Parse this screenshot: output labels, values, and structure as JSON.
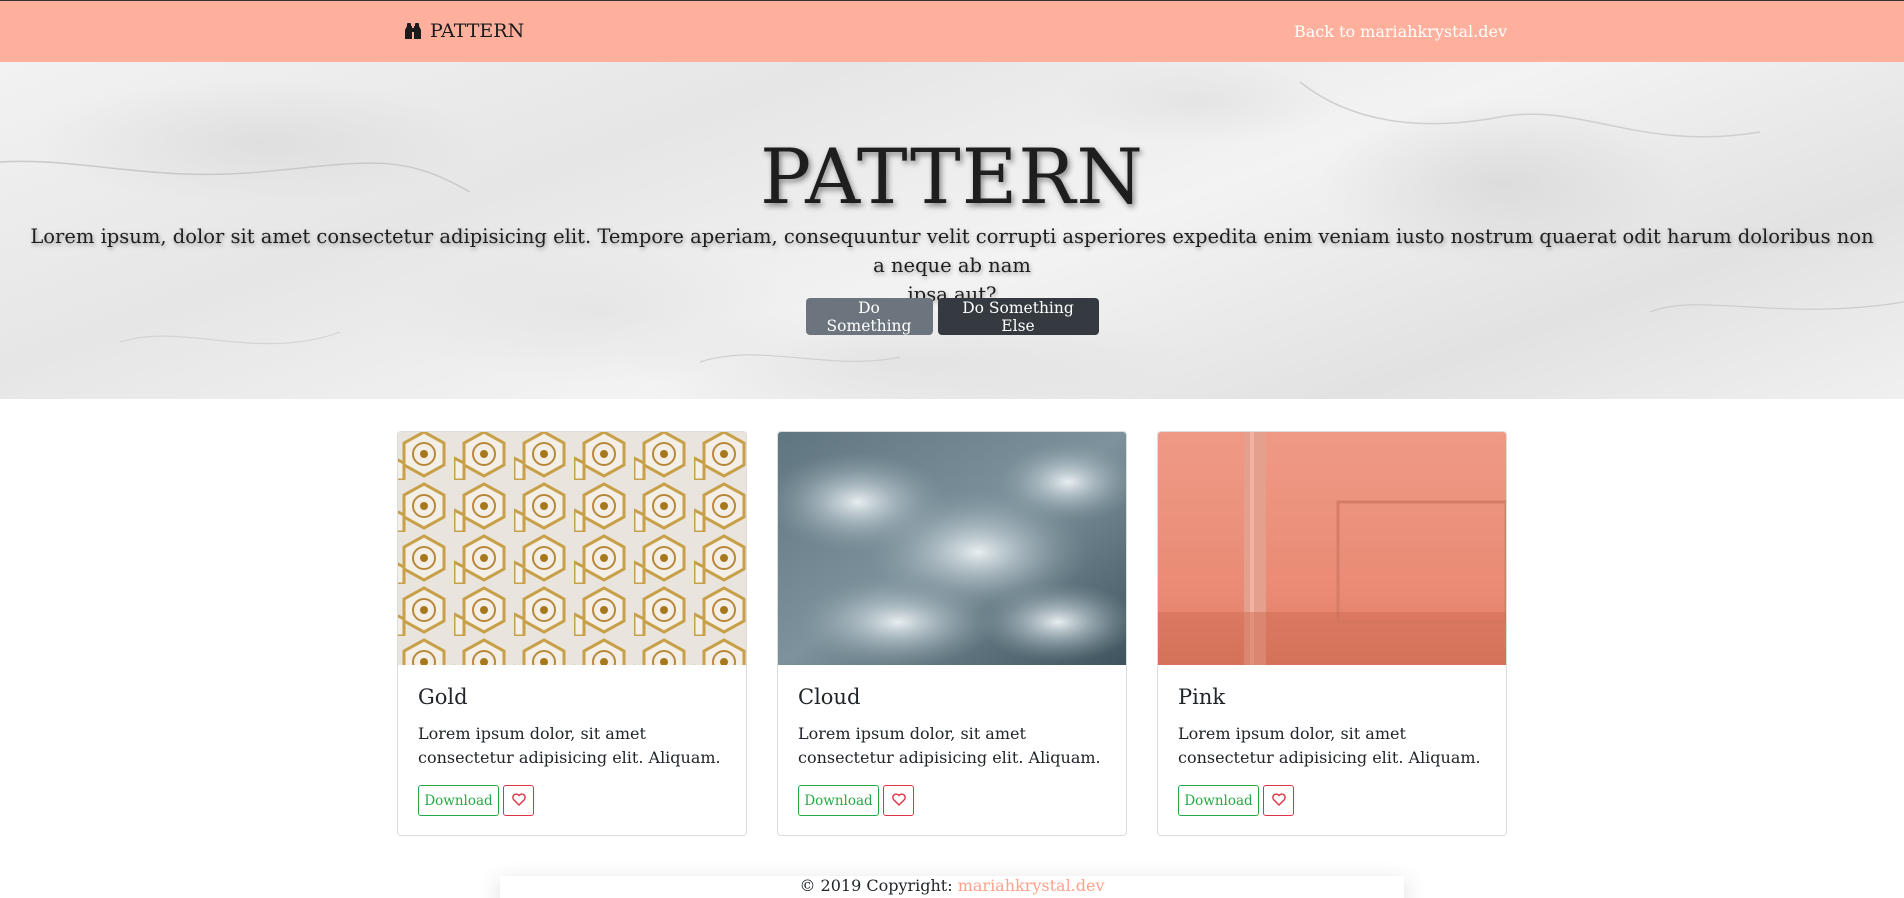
{
  "navbar": {
    "brand_icon": "binoculars-icon",
    "brand_label": "PATTERN",
    "back_link": "Back to mariahkrystal.dev",
    "background": "#ffb09c"
  },
  "hero": {
    "title": "PATTERN",
    "text_line1": "Lorem ipsum, dolor sit amet consectetur adipisicing elit. Tempore aperiam, consequuntur velit corrupti asperiores expedita enim veniam iusto nostrum quaerat odit harum doloribus non a neque ab nam",
    "text_line2": "ipsa aut?",
    "primary_button": "Do Something",
    "secondary_button": "Do Something Else"
  },
  "cards": [
    {
      "title": "Gold",
      "text": "Lorem ipsum dolor, sit amet consectetur adipisicing elit. Aliquam.",
      "download_label": "Download",
      "like_icon": "heart-icon"
    },
    {
      "title": "Cloud",
      "text": "Lorem ipsum dolor, sit amet consectetur adipisicing elit. Aliquam.",
      "download_label": "Download",
      "like_icon": "heart-icon"
    },
    {
      "title": "Pink",
      "text": "Lorem ipsum dolor, sit amet consectetur adipisicing elit. Aliquam.",
      "download_label": "Download",
      "like_icon": "heart-icon"
    }
  ],
  "footer": {
    "copyright": "© 2019 Copyright: ",
    "link": "mariahkrystal.dev"
  },
  "colors": {
    "accent": "#ffb09c",
    "success": "#28a745",
    "danger": "#dc3545"
  }
}
